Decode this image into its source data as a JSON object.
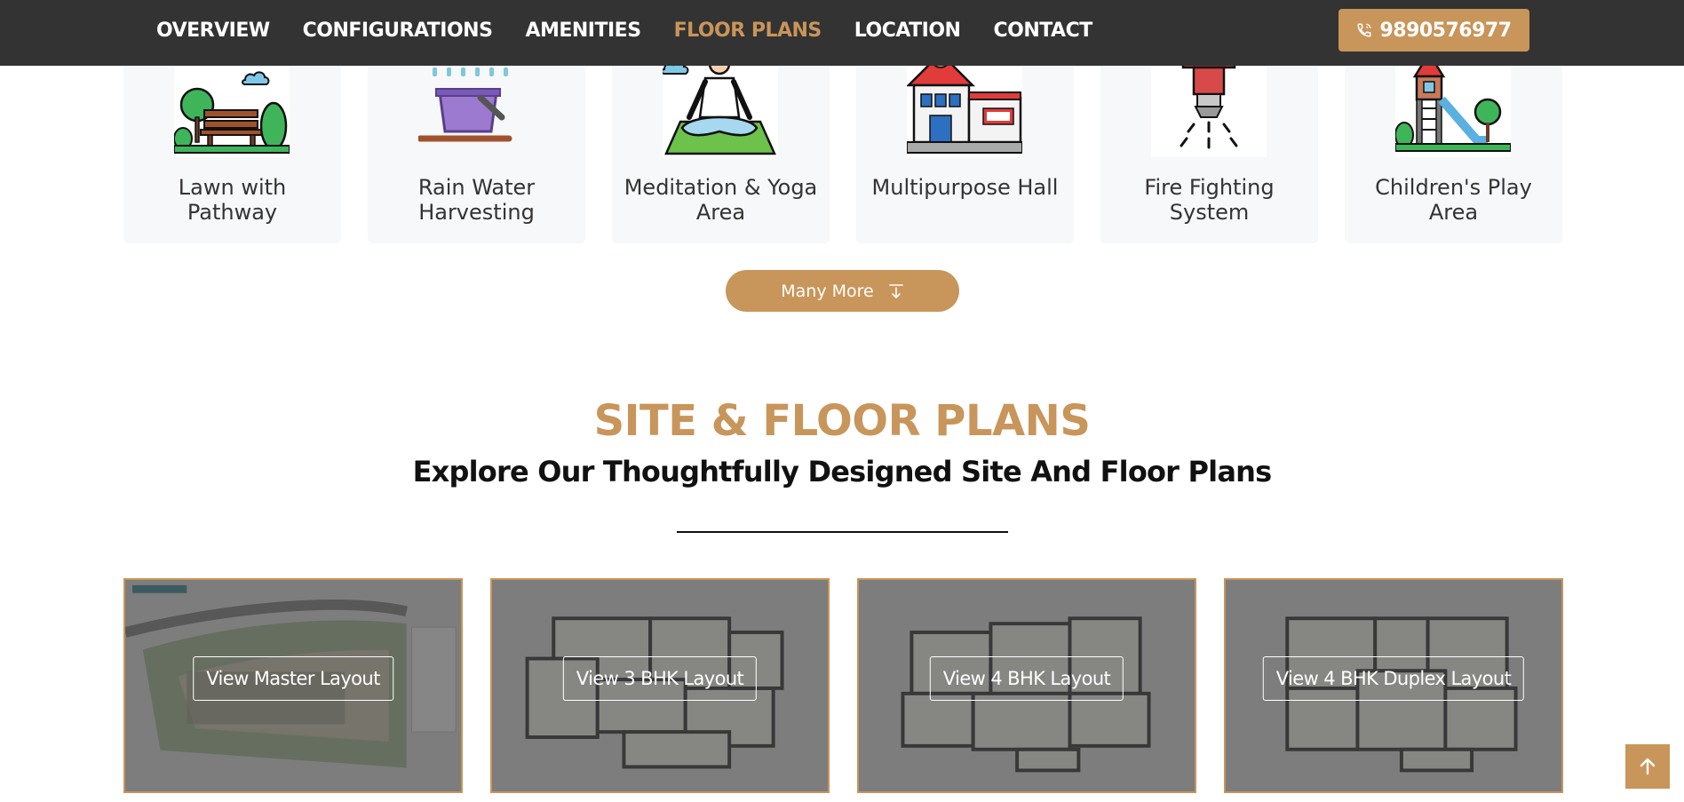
{
  "nav": {
    "items": [
      {
        "label": "OVERVIEW",
        "active": false
      },
      {
        "label": "CONFIGURATIONS",
        "active": false
      },
      {
        "label": "AMENITIES",
        "active": false
      },
      {
        "label": "FLOOR PLANS",
        "active": true
      },
      {
        "label": "LOCATION",
        "active": false
      },
      {
        "label": "CONTACT",
        "active": false
      }
    ],
    "phone": "9890576977",
    "phone_icon": "phone-icon"
  },
  "amenities": {
    "items": [
      {
        "label": "Lawn with Pathway",
        "icon": "park-bench-icon"
      },
      {
        "label": "Rain Water Harvesting",
        "icon": "rain-bucket-icon"
      },
      {
        "label": "Meditation & Yoga Area",
        "icon": "yoga-icon"
      },
      {
        "label": "Multipurpose Hall",
        "icon": "building-icon"
      },
      {
        "label": "Fire Fighting System",
        "icon": "sprinkler-icon"
      },
      {
        "label": "Children's Play Area",
        "icon": "playground-icon"
      }
    ],
    "more_label": "Many More",
    "more_icon": "arrow-down-icon"
  },
  "plans_section": {
    "title": "SITE & FLOOR PLANS",
    "subtitle": "Explore Our Thoughtfully Designed Site And Floor Plans",
    "cards": [
      {
        "label": "View Master Layout",
        "image": "master-plan-image"
      },
      {
        "label": "View 3 BHK Layout",
        "image": "floor-plan-image"
      },
      {
        "label": "View 4 BHK Layout",
        "image": "floor-plan-image"
      },
      {
        "label": "View 4 BHK Duplex Layout",
        "image": "floor-plan-image"
      }
    ]
  },
  "scroll_top": {
    "icon": "arrow-up-icon"
  },
  "colors": {
    "accent": "#c8955a",
    "nav_bg": "#333333",
    "card_bg": "#f7f8fa"
  }
}
